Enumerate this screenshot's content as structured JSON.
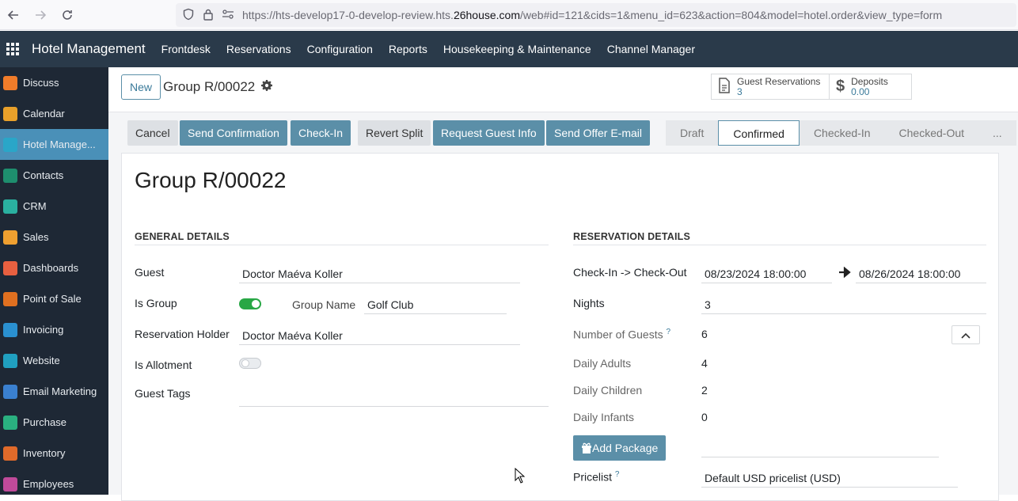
{
  "browser": {
    "url_prefix": "https://hts-develop17-0-develop-review.hts.",
    "url_domain": "26house.com",
    "url_suffix": "/web#id=121&cids=1&menu_id=623&action=804&model=hotel.order&view_type=form"
  },
  "topnav": {
    "app_title": "Hotel Management",
    "menu": [
      "Frontdesk",
      "Reservations",
      "Configuration",
      "Reports",
      "Housekeeping & Maintenance",
      "Channel Manager"
    ]
  },
  "sidebar": {
    "items": [
      {
        "label": "Discuss",
        "color": "#f07c2a"
      },
      {
        "label": "Calendar",
        "color": "#e8a02a"
      },
      {
        "label": "Hotel Manage...",
        "color": "#2aa6c8"
      },
      {
        "label": "Contacts",
        "color": "#1e8e6e"
      },
      {
        "label": "CRM",
        "color": "#2ab0a0"
      },
      {
        "label": "Sales",
        "color": "#f0a030"
      },
      {
        "label": "Dashboards",
        "color": "#e86040"
      },
      {
        "label": "Point of Sale",
        "color": "#e07020"
      },
      {
        "label": "Invoicing",
        "color": "#2a90d0"
      },
      {
        "label": "Website",
        "color": "#20a0c0"
      },
      {
        "label": "Email Marketing",
        "color": "#3a80d0"
      },
      {
        "label": "Purchase",
        "color": "#2ab080"
      },
      {
        "label": "Inventory",
        "color": "#e06a2a"
      },
      {
        "label": "Employees",
        "color": "#c04a9a"
      }
    ]
  },
  "control": {
    "new_label": "New",
    "breadcrumb": "Group R/00022",
    "guest_reservations_label": "Guest Reservations",
    "guest_reservations_value": "3",
    "deposits_label": "Deposits",
    "deposits_value": "0.00"
  },
  "actions": {
    "cancel": "Cancel",
    "send_confirmation": "Send Confirmation",
    "check_in": "Check-In",
    "revert_split": "Revert Split",
    "request_guest_info": "Request Guest Info",
    "send_offer_email": "Send Offer E-mail"
  },
  "status": {
    "stages": [
      "Draft",
      "Confirmed",
      "Checked-In",
      "Checked-Out",
      "..."
    ],
    "current": "Confirmed"
  },
  "form": {
    "title": "Group R/00022",
    "general": {
      "section": "GENERAL DETAILS",
      "guest_label": "Guest",
      "guest_value": "Doctor Maéva Koller",
      "is_group_label": "Is Group",
      "is_group": true,
      "group_name_label": "Group Name",
      "group_name_value": "Golf Club",
      "holder_label": "Reservation Holder",
      "holder_value": "Doctor Maéva Koller",
      "is_allotment_label": "Is Allotment",
      "is_allotment": false,
      "guest_tags_label": "Guest Tags"
    },
    "reservation": {
      "section": "RESERVATION DETAILS",
      "checkin_label": "Check-In -> Check-Out",
      "checkin_value": "08/23/2024 18:00:00",
      "checkout_value": "08/26/2024 18:00:00",
      "nights_label": "Nights",
      "nights_value": "3",
      "guests_label": "Number of Guests",
      "guests_value": "6",
      "adults_label": "Daily Adults",
      "adults_value": "4",
      "children_label": "Daily Children",
      "children_value": "2",
      "infants_label": "Daily Infants",
      "infants_value": "0",
      "add_package": "Add Package",
      "pricelist_label": "Pricelist",
      "pricelist_value": "Default USD pricelist (USD)"
    }
  }
}
